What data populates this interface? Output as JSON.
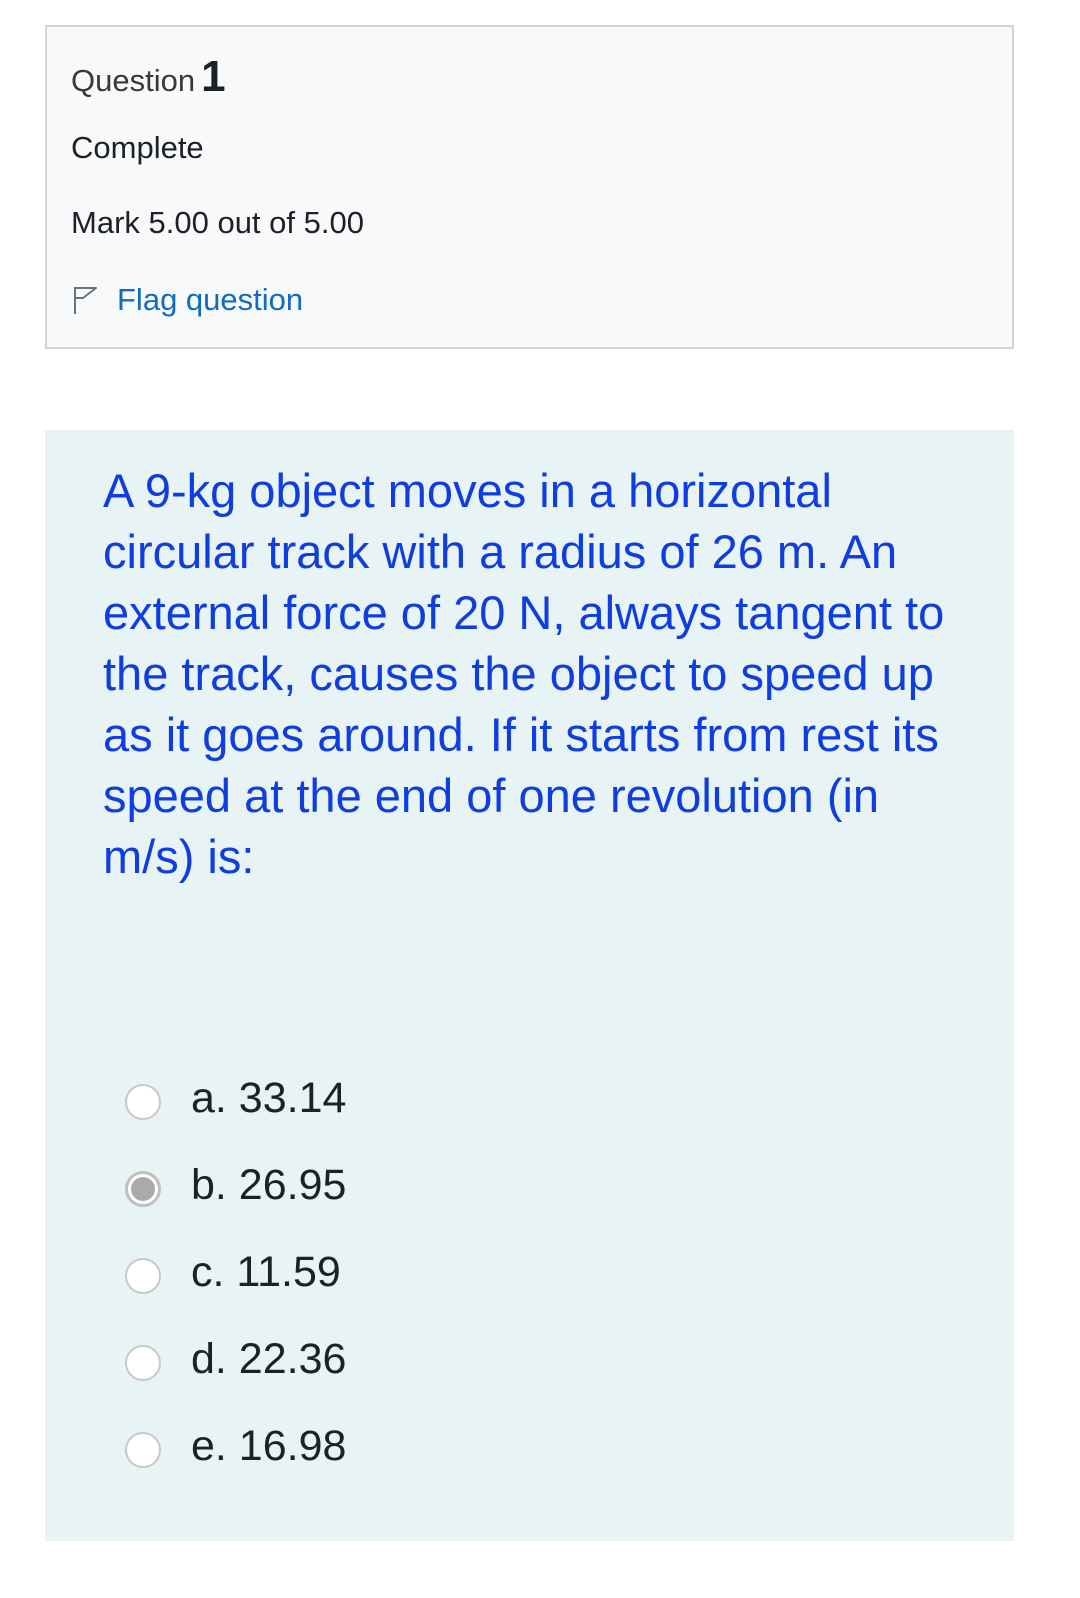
{
  "info": {
    "question_label": "Question",
    "question_number": "1",
    "state": "Complete",
    "grade": "Mark 5.00 out of 5.00",
    "flag_label": "Flag question",
    "flag_icon": "flag-icon"
  },
  "question": {
    "text": "A 9-kg object moves in a horizontal circular track with a radius of 26 m. An external force of 20 N, always tangent to the track, causes the object to speed up as it goes around. If it starts from rest its speed at the end of one revolution (in m/s) is:"
  },
  "answers": [
    {
      "label": "a. 33.14",
      "selected": false
    },
    {
      "label": "b. 26.95",
      "selected": true
    },
    {
      "label": "c. 11.59",
      "selected": false
    },
    {
      "label": "d. 22.36",
      "selected": false
    },
    {
      "label": "e. 16.98",
      "selected": false
    }
  ],
  "colors": {
    "question_text": "#0f3de0",
    "link": "#0f6cbf",
    "info_background": "#f8f9fa",
    "content_background": "#e7f3f5"
  }
}
